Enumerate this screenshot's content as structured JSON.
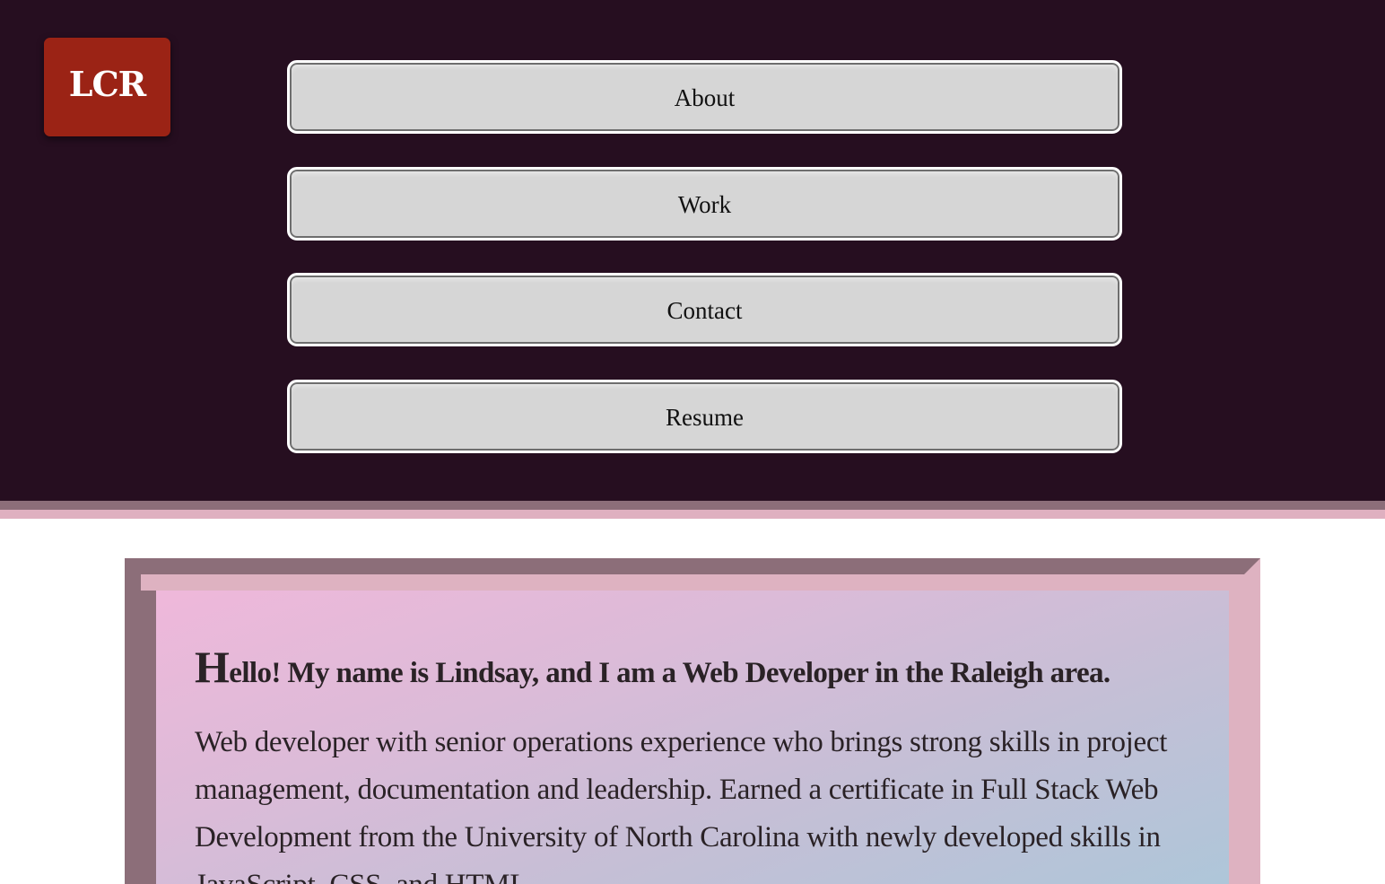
{
  "header": {
    "logo_text": "LCR",
    "nav": {
      "about": "About",
      "work": "Work",
      "contact": "Contact",
      "resume": "Resume"
    }
  },
  "intro": {
    "title_initial": "H",
    "title_rest": "ello! My name is Lindsay, and I am a Web Developer in the Raleigh area.",
    "body": "Web developer with senior operations experience who brings strong skills in project management, documentation and leadership. Earned a certificate in Full Stack Web Development from the University of North Carolina with newly developed skills in JavaScript, CSS, and HTML."
  },
  "colors": {
    "header_bg": "#260e20",
    "logo_bg": "#9b2315",
    "button_bg": "#d6d6d6",
    "stripe_dark": "#8c6e79",
    "stripe_light": "#dfb0c0",
    "card_gradient_start": "#efb8da",
    "card_gradient_end": "#aec6d9"
  }
}
